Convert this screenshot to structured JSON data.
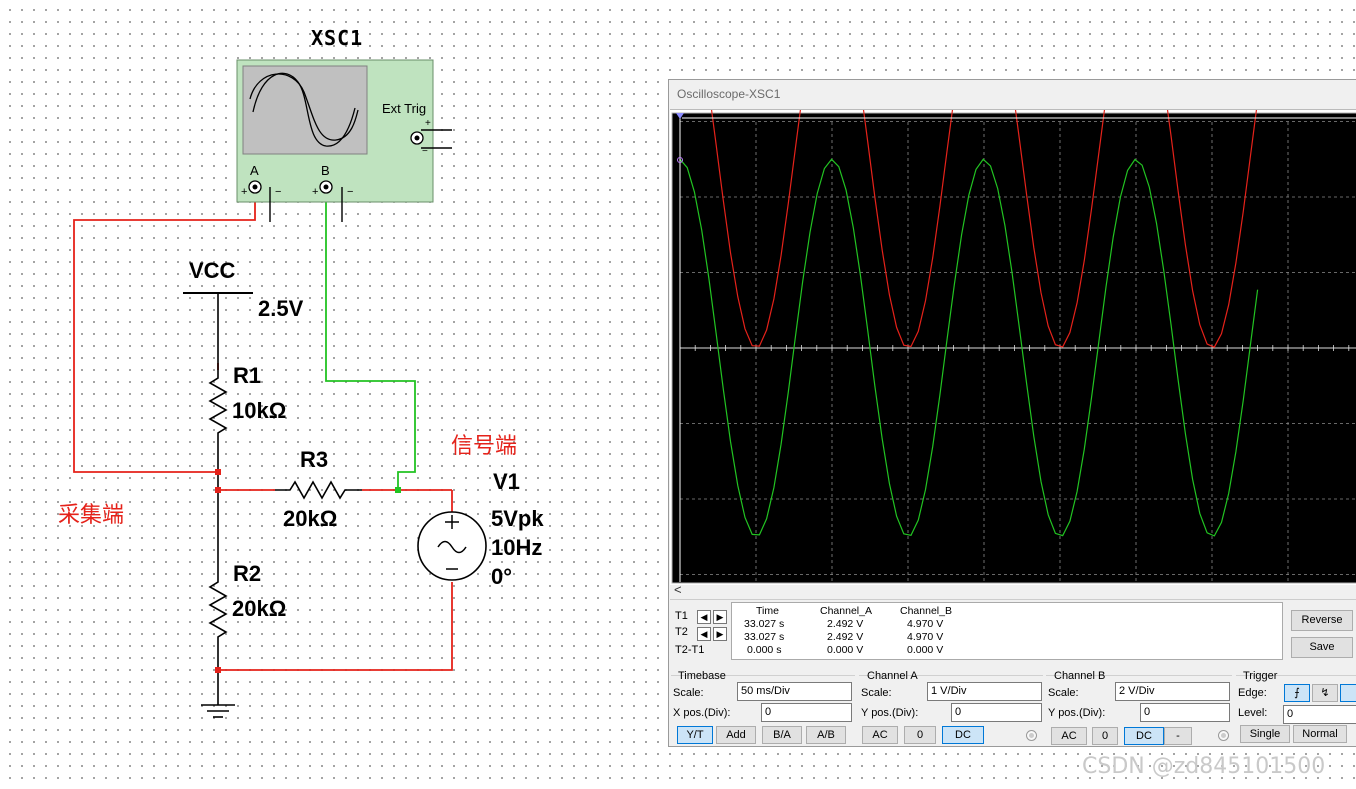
{
  "schematic": {
    "instrument_label": "XSC1",
    "ext_trig_label": "Ext Trig",
    "channel_a_label": "A",
    "channel_b_label": "B",
    "plus_sign": "+",
    "minus_sign": "−",
    "vcc_label": "VCC",
    "vcc_value": "2.5V",
    "r1_name": "R1",
    "r1_value": "10kΩ",
    "r2_name": "R2",
    "r2_value": "20kΩ",
    "r3_name": "R3",
    "r3_value": "20kΩ",
    "v1_name": "V1",
    "v1_amplitude": "5Vpk",
    "v1_frequency": "10Hz",
    "v1_phase": "0°",
    "note_acquire": "采集端",
    "note_signal": "信号端",
    "colors": {
      "wire_a": "#e5221a",
      "wire_b": "#22c322",
      "junction": "#e5221a",
      "instrument_body": "#bfe3bf"
    }
  },
  "oscilloscope": {
    "window_title": "Oscilloscope-XSC1",
    "screen": {
      "background": "#000000",
      "channel_a_color": "#e5221a",
      "channel_b_color": "#22c322",
      "cursor_color": "#ffffff"
    },
    "cursors": {
      "t1_label": "T1",
      "t2_label": "T2",
      "diff_label": "T2-T1"
    },
    "readout": {
      "headers": [
        "Time",
        "Channel_A",
        "Channel_B"
      ],
      "rows": [
        {
          "time": "33.027 s",
          "a": "2.492 V",
          "b": "4.970 V"
        },
        {
          "time": "33.027 s",
          "a": "2.492 V",
          "b": "4.970 V"
        },
        {
          "time": "0.000 s",
          "a": "0.000 V",
          "b": "0.000 V"
        }
      ]
    },
    "buttons": {
      "reverse": "Reverse",
      "save": "Save"
    },
    "timebase": {
      "title": "Timebase",
      "scale_label": "Scale:",
      "scale_value": "50 ms/Div",
      "xpos_label": "X pos.(Div):",
      "xpos_value": "0",
      "modes": [
        "Y/T",
        "Add",
        "B/A",
        "A/B"
      ],
      "selected_mode": "Y/T"
    },
    "channel_a": {
      "title": "Channel A",
      "scale_label": "Scale:",
      "scale_value": "1  V/Div",
      "ypos_label": "Y pos.(Div):",
      "ypos_value": "0",
      "coupling": [
        "AC",
        "0",
        "DC"
      ],
      "selected_coupling": "DC"
    },
    "channel_b": {
      "title": "Channel B",
      "scale_label": "Scale:",
      "scale_value": "2  V/Div",
      "ypos_label": "Y pos.(Div):",
      "ypos_value": "0",
      "coupling": [
        "AC",
        "0",
        "DC",
        "-"
      ],
      "selected_coupling": "DC"
    },
    "trigger": {
      "title": "Trigger",
      "edge_label": "Edge:",
      "level_label": "Level:",
      "level_value": "0",
      "modes": [
        "Single",
        "Normal"
      ]
    }
  },
  "chart_data": {
    "type": "line",
    "xlabel": "",
    "ylabel": "",
    "x_unit_per_div": "50 ms/Div",
    "xlim_divisions": [
      0,
      10
    ],
    "ylim_divisions": [
      -4,
      4
    ],
    "grid": true,
    "series": [
      {
        "name": "Channel_A",
        "color": "#e5221a",
        "scale_v_per_div": 1,
        "offset_v": 2.5,
        "amplitude_v": 2.5,
        "frequency_hz": 10,
        "phase_deg": 90,
        "v_at_cursor": 2.492
      },
      {
        "name": "Channel_B",
        "color": "#22c322",
        "scale_v_per_div": 2,
        "offset_v": 0,
        "amplitude_v": 5,
        "frequency_hz": 10,
        "phase_deg": 90,
        "v_at_cursor": 4.97
      }
    ]
  },
  "watermark": "CSDN @zd845101500"
}
